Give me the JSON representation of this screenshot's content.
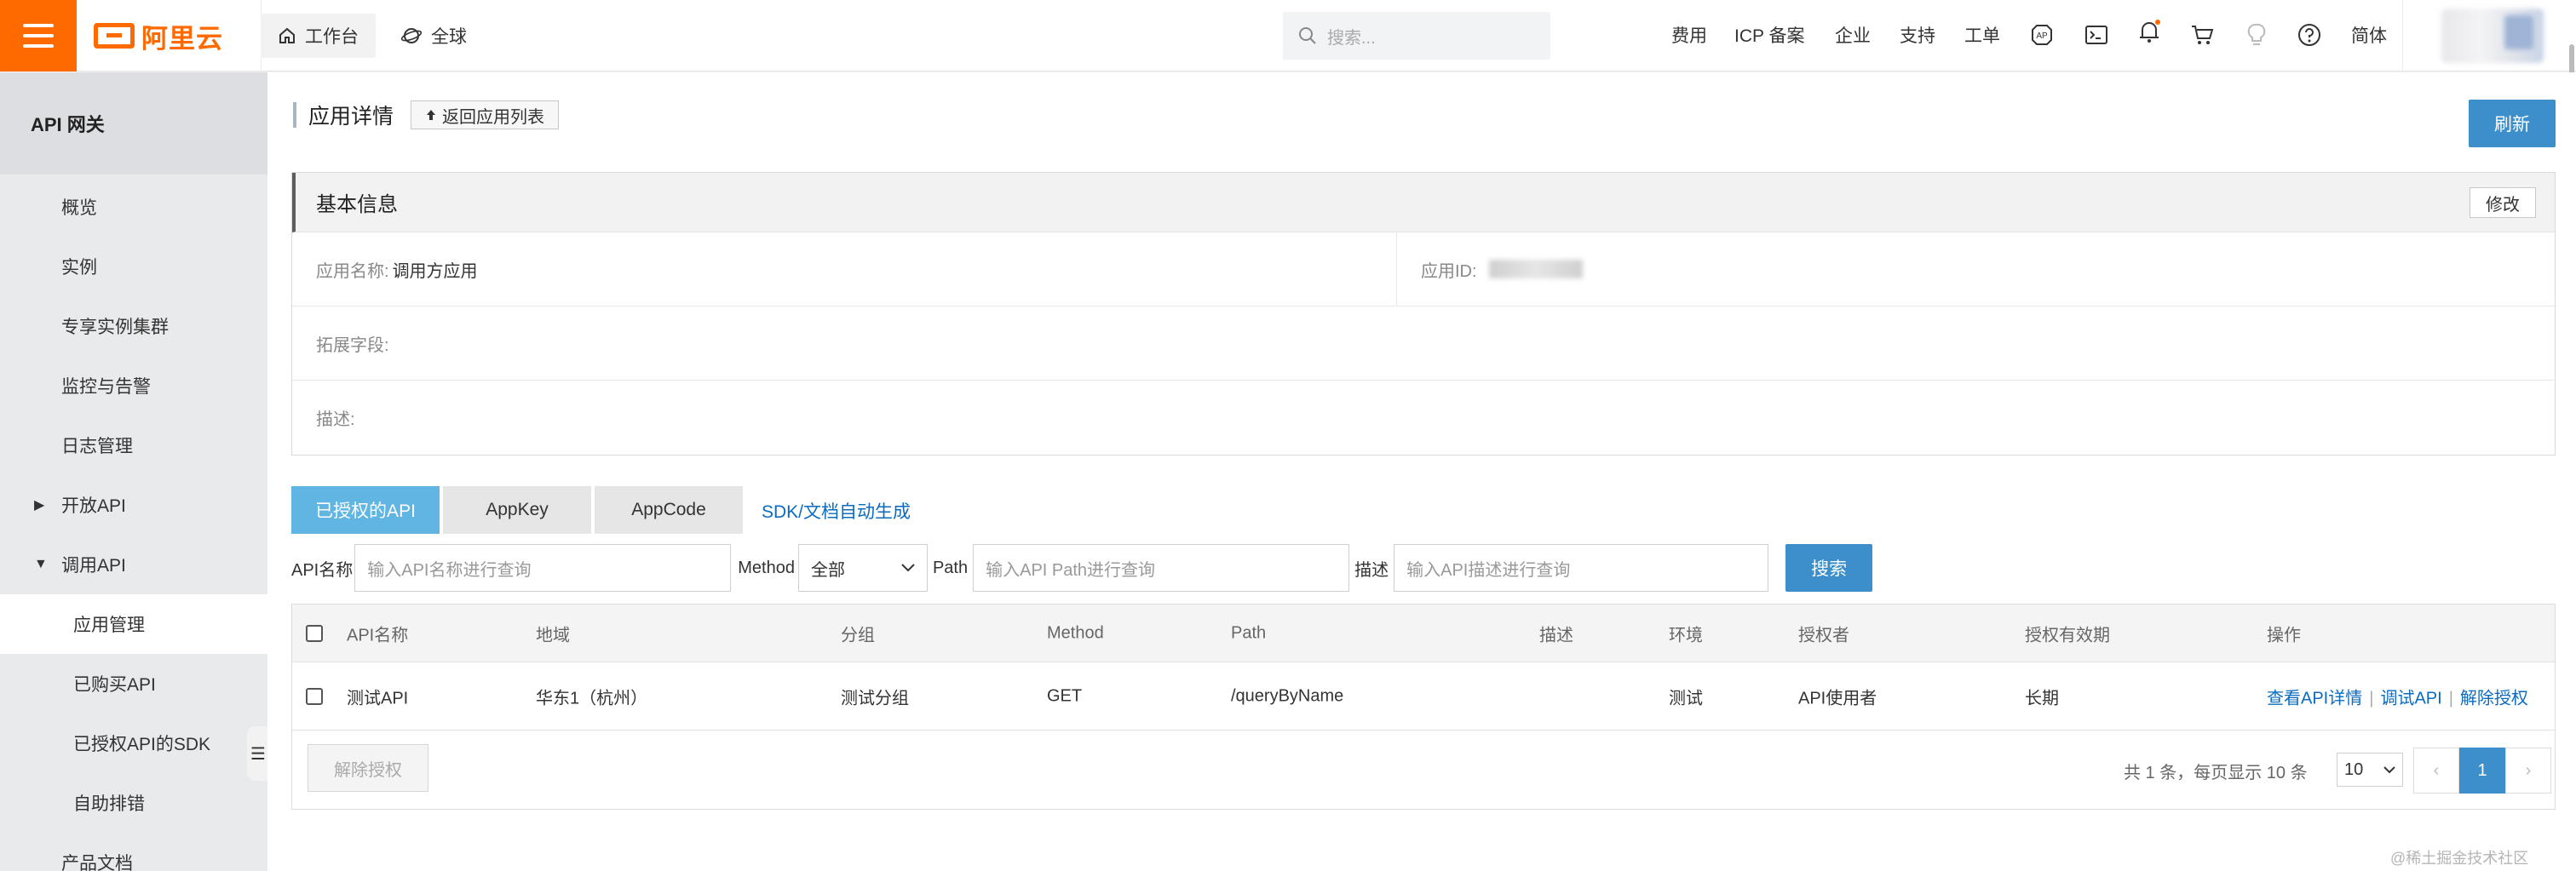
{
  "topbar": {
    "logo_text": "阿里云",
    "workbench": "工作台",
    "region": "全球",
    "search_placeholder": "搜索...",
    "links": [
      "费用",
      "ICP 备案",
      "企业",
      "支持",
      "工单"
    ],
    "lang": "简体",
    "brand_color": "#ff6a00"
  },
  "sidebar": {
    "title": "API 网关",
    "items": [
      {
        "label": "概览"
      },
      {
        "label": "实例"
      },
      {
        "label": "专享实例集群"
      },
      {
        "label": "监控与告警"
      },
      {
        "label": "日志管理"
      },
      {
        "label": "开放API",
        "caret": "▶"
      },
      {
        "label": "调用API",
        "caret": "▼"
      },
      {
        "label": "应用管理"
      },
      {
        "label": "已购买API"
      },
      {
        "label": "已授权API的SDK"
      },
      {
        "label": "自助排错"
      },
      {
        "label": "产品文档"
      }
    ]
  },
  "page": {
    "title": "应用详情",
    "back_label": "返回应用列表",
    "refresh_label": "刷新"
  },
  "basic_info": {
    "title": "基本信息",
    "edit_label": "修改",
    "app_name_label": "应用名称:",
    "app_name_value": "调用方应用",
    "app_id_label": "应用ID:",
    "ext_label": "拓展字段:",
    "desc_label": "描述:"
  },
  "tabs": [
    "已授权的API",
    "AppKey",
    "AppCode"
  ],
  "sdk_link": "SDK/文档自动生成",
  "filter": {
    "api_name_label": "API名称",
    "api_name_placeholder": "输入API名称进行查询",
    "method_label": "Method",
    "method_value": "全部",
    "path_label": "Path",
    "path_placeholder": "输入API Path进行查询",
    "desc_label": "描述",
    "desc_placeholder": "输入API描述进行查询",
    "search_label": "搜索"
  },
  "table": {
    "headers": [
      "API名称",
      "地域",
      "分组",
      "Method",
      "Path",
      "描述",
      "环境",
      "授权者",
      "授权有效期",
      "操作"
    ],
    "rows": [
      {
        "name": "测试API",
        "region": "华东1（杭州）",
        "group": "测试分组",
        "method": "GET",
        "path": "/queryByName",
        "desc": "",
        "env": "测试",
        "grantor": "API使用者",
        "validity": "长期",
        "ops": [
          "查看API详情",
          "调试API",
          "解除授权"
        ]
      }
    ],
    "revoke_label": "解除授权",
    "pager_text": "共 1 条，每页显示 10 条",
    "page_size": "10",
    "current_page": "1",
    "prev": "‹",
    "next": "›"
  },
  "watermark": "@稀土掘金技术社区"
}
